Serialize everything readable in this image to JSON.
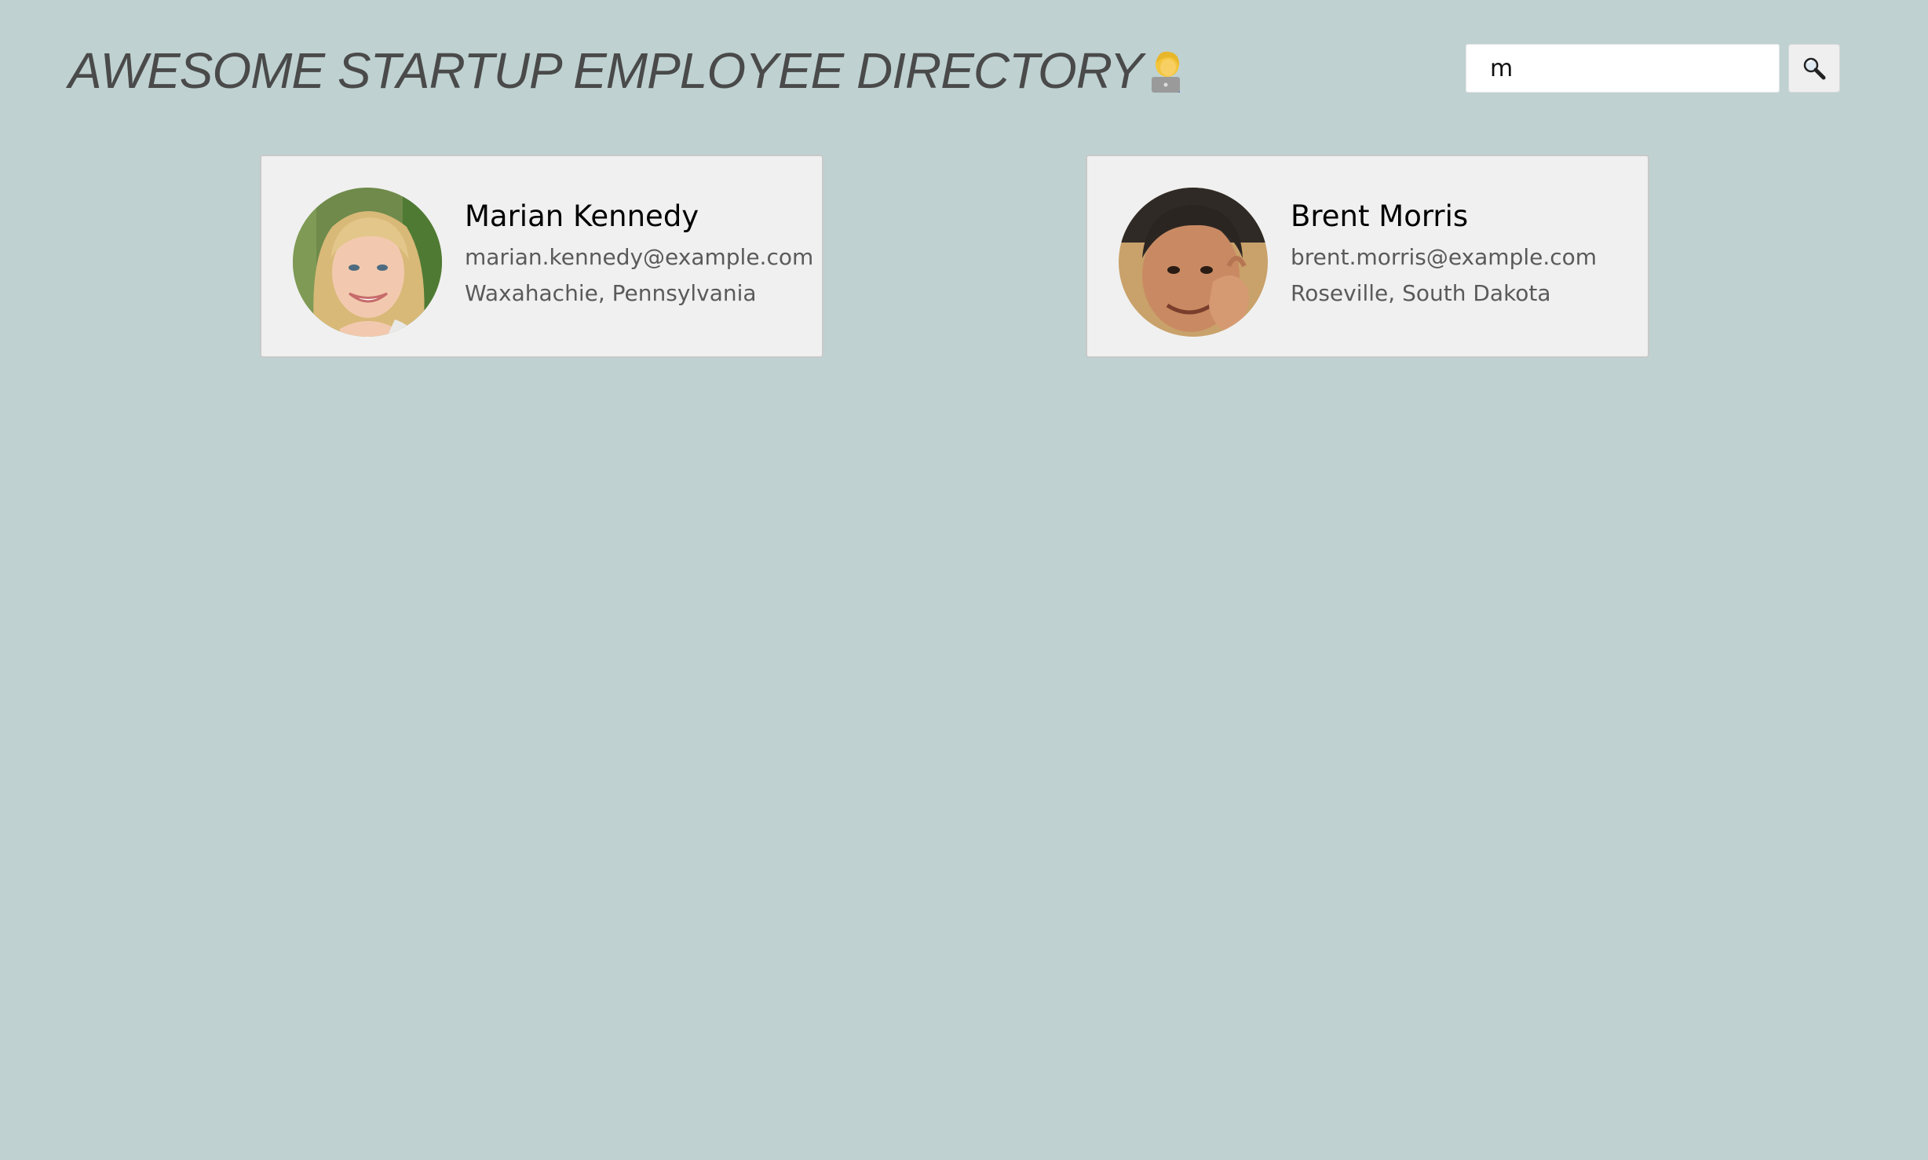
{
  "header": {
    "title": "AWESOME STARTUP EMPLOYEE DIRECTORY",
    "title_emoji_icon": "technologist-icon"
  },
  "search": {
    "value": "m",
    "button_icon": "search-icon"
  },
  "employees": [
    {
      "name": "Marian Kennedy",
      "email": "marian.kennedy@example.com",
      "location": "Waxahachie, Pennsylvania"
    },
    {
      "name": "Brent Morris",
      "email": "brent.morris@example.com",
      "location": "Roseville, South Dakota"
    }
  ],
  "colors": {
    "background": "#bfd1d1",
    "card": "#f0f0f0",
    "title": "#4a4a4a",
    "secondary_text": "#5a5a5a"
  }
}
